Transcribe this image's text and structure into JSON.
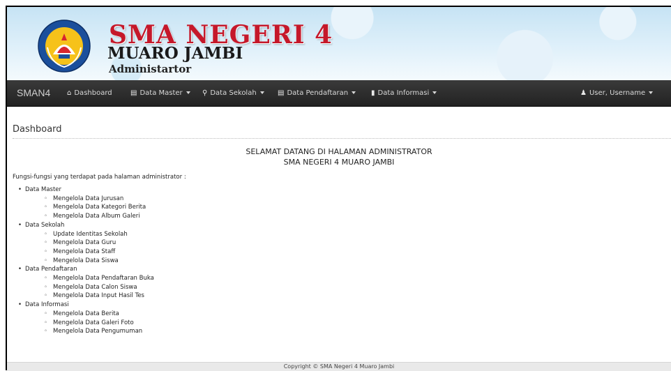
{
  "header": {
    "title": "SMA NEGERI 4",
    "subtitle": "MUARO JAMBI",
    "role": "Administartor"
  },
  "navbar": {
    "brand": "SMAN4",
    "items": [
      {
        "label": "Dashboard",
        "icon": "home-icon",
        "dropdown": false
      },
      {
        "label": "Data Master",
        "icon": "book-icon",
        "dropdown": true
      },
      {
        "label": "Data Sekolah",
        "icon": "map-marker-icon",
        "dropdown": true
      },
      {
        "label": "Data Pendaftaran",
        "icon": "list-icon",
        "dropdown": true
      },
      {
        "label": "Data Informasi",
        "icon": "file-icon",
        "dropdown": true
      }
    ],
    "user": {
      "label": "User, Username",
      "icon": "user-icon"
    }
  },
  "page": {
    "title": "Dashboard",
    "welcome_line1": "SELAMAT DATANG DI HALAMAN ADMINISTRATOR",
    "welcome_line2": "SMA NEGERI 4 MUARO JAMBI",
    "intro": "Fungsi-fungsi yang terdapat pada halaman administrator :",
    "sections": [
      {
        "name": "Data Master",
        "items": [
          "Mengelola Data Jurusan",
          "Mengelola Data Kategori Berita",
          "Mengelola Data Album Galeri"
        ]
      },
      {
        "name": "Data Sekolah",
        "items": [
          "Update Identitas Sekolah",
          "Mengelola Data Guru",
          "Mengelola Data Staff",
          "Mengelola Data Siswa"
        ]
      },
      {
        "name": "Data Pendaftaran",
        "items": [
          "Mengelola Data Pendaftaran Buka",
          "Mengelola Data Calon Siswa",
          "Mengelola Data Input Hasil Tes"
        ]
      },
      {
        "name": "Data Informasi",
        "items": [
          "Mengelola Data Berita",
          "Mengelola Data Galeri Foto",
          "Mengelola Data Pengumuman"
        ]
      }
    ]
  },
  "footer": {
    "text": "Copyright © SMA Negeri 4 Muaro Jambi"
  },
  "colors": {
    "title_red": "#c5182a",
    "navbar_bg": "#222222"
  }
}
